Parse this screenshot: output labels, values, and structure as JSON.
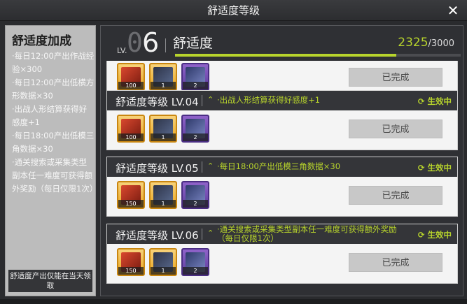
{
  "window": {
    "title": "舒适度等级",
    "close_glyph": "✕"
  },
  "sidebar": {
    "title": "舒适度加成",
    "bullets": [
      "·每日12:00产出作战经验×300",
      "·每日12:00产出低横方形数据×30",
      "·出战人形结算获得好感度+1",
      "·每日18:00产出低模三角数据×30",
      "·通关搜索或采集类型副本任一难度可获得额外奖励（每日仅限1次）"
    ],
    "note": "舒适度产出仅能在当天领取"
  },
  "header": {
    "lv_label": "LV.",
    "lv_prefix": "0",
    "lv_value": "6",
    "title": "舒适度",
    "current": "2325",
    "max": "/3000",
    "progress_fraction": 0.775
  },
  "cards": [
    {
      "title": "",
      "desc": "",
      "status": "",
      "items": [
        "100",
        "1",
        "2"
      ],
      "button": "已完成"
    },
    {
      "title": "舒适度等级 LV.04",
      "desc": "·出战人形结算获得好感度+1",
      "status": "生效中",
      "items": [
        "100",
        "1",
        "2"
      ],
      "button": "已完成"
    },
    {
      "title": "舒适度等级 LV.05",
      "desc": "·每日18:00产出低模三角数据×30",
      "status": "生效中",
      "items": [
        "150",
        "1",
        "2"
      ],
      "button": "已完成"
    },
    {
      "title": "舒适度等级 LV.06",
      "desc": "·通关搜索或采集类型副本任一难度可获得额外奖励（每日仅限1次）",
      "status": "生效中",
      "items": [
        "150",
        "1",
        "2"
      ],
      "button": "已完成"
    }
  ],
  "icons": {
    "status": "refresh-icon",
    "arrow": "double-chevron-up-icon"
  },
  "colors": {
    "accent": "#b8d42c",
    "gold_item": "#e9a41c",
    "purple_item": "#5b3c9c"
  }
}
